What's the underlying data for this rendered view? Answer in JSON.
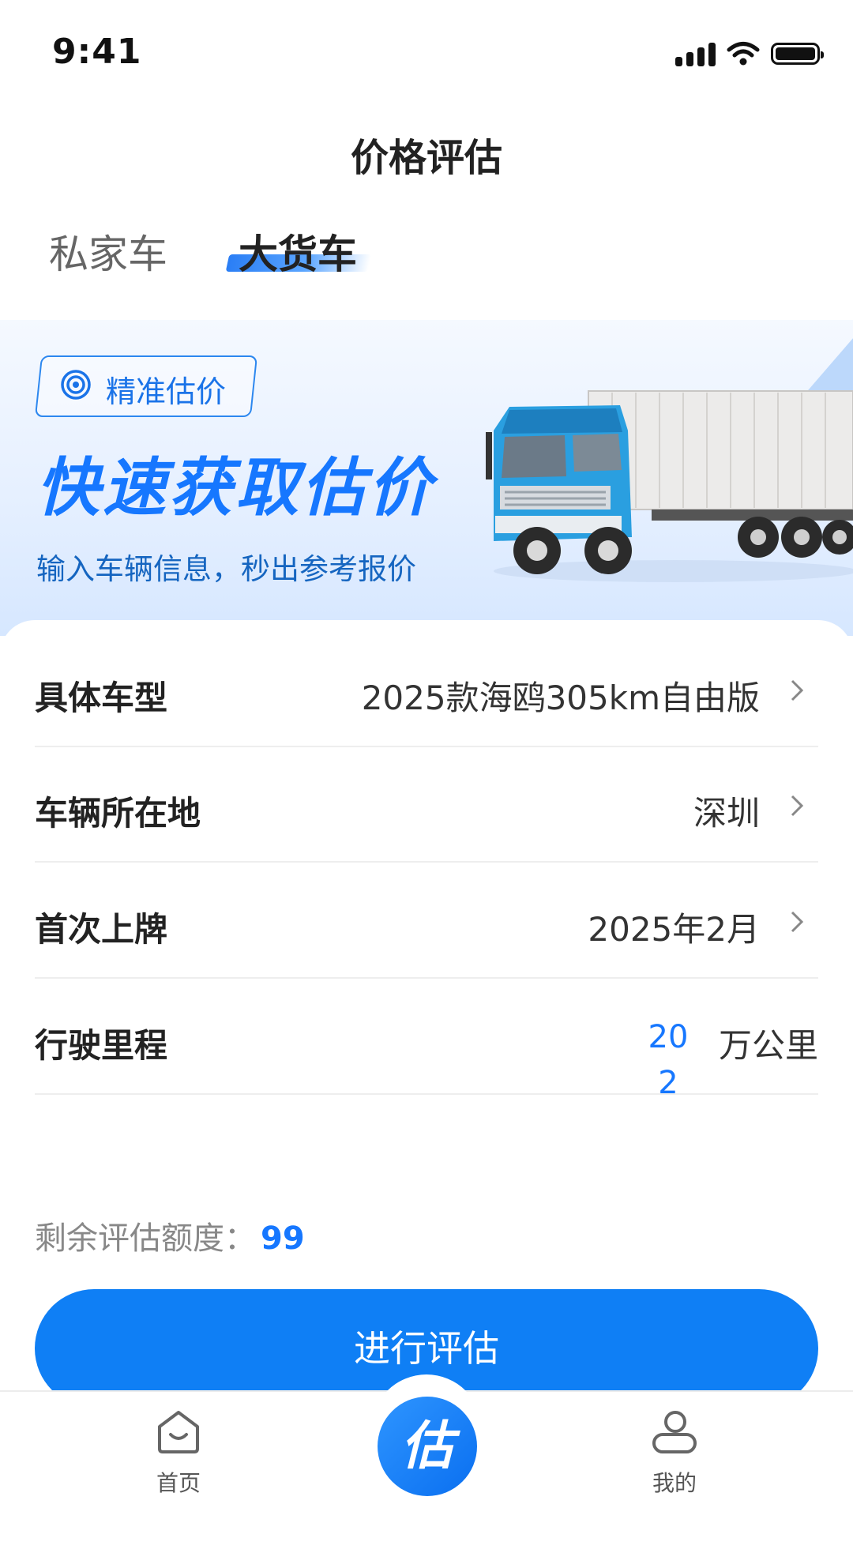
{
  "status_bar": {
    "time": "9:41"
  },
  "header": {
    "title": "价格评估"
  },
  "tabs": [
    {
      "label": "私家车",
      "active": false
    },
    {
      "label": "大货车",
      "active": true
    }
  ],
  "banner": {
    "badge": "精准估价",
    "title": "快速获取估价",
    "subtitle": "输入车辆信息，秒出参考报价"
  },
  "form": {
    "rows": [
      {
        "label": "具体车型",
        "value": "2025款海鸥305km自由版"
      },
      {
        "label": "车辆所在地",
        "value": "深圳"
      },
      {
        "label": "首次上牌",
        "value": "2025年2月"
      },
      {
        "label": "行驶里程",
        "value": "202",
        "unit": "万公里"
      }
    ]
  },
  "quota": {
    "label": "剩余评估额度：",
    "value": "99"
  },
  "action": {
    "label": "进行评估"
  },
  "tabbar": {
    "home": "首页",
    "center": "估",
    "mine": "我的"
  },
  "colors": {
    "accent": "#1677ff",
    "button": "#0f7ff5"
  }
}
